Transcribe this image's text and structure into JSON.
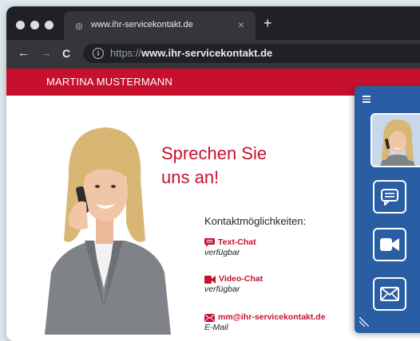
{
  "browser": {
    "tab_title": "www.ihr-servicekontakt.de",
    "tab_close": "×",
    "new_tab": "+",
    "nav_back": "←",
    "nav_forward": "→",
    "nav_reload": "C",
    "url_scheme": "https://",
    "url_host": "www.ihr-servicekontakt.de"
  },
  "header": {
    "owner_name": "MARTINA MUSTERMANN"
  },
  "main": {
    "headline_line1": "Sprechen Sie",
    "headline_line2": "uns an!",
    "contact_title": "Kontaktmöglichkeiten:",
    "contacts": [
      {
        "icon": "chat-icon",
        "label": "Text-Chat",
        "status": "verfügbar"
      },
      {
        "icon": "video-icon",
        "label": "Video-Chat",
        "status": "verfügbar"
      },
      {
        "icon": "mail-icon",
        "label": "mm@ihr-servicekontakt.de",
        "status": "E-Mail"
      }
    ]
  },
  "panel": {
    "buttons": [
      "chat-icon",
      "video-icon",
      "mail-icon"
    ]
  },
  "colors": {
    "brand_red": "#c7102e",
    "panel_blue": "#2a5ea4",
    "browser_dark": "#202124"
  }
}
